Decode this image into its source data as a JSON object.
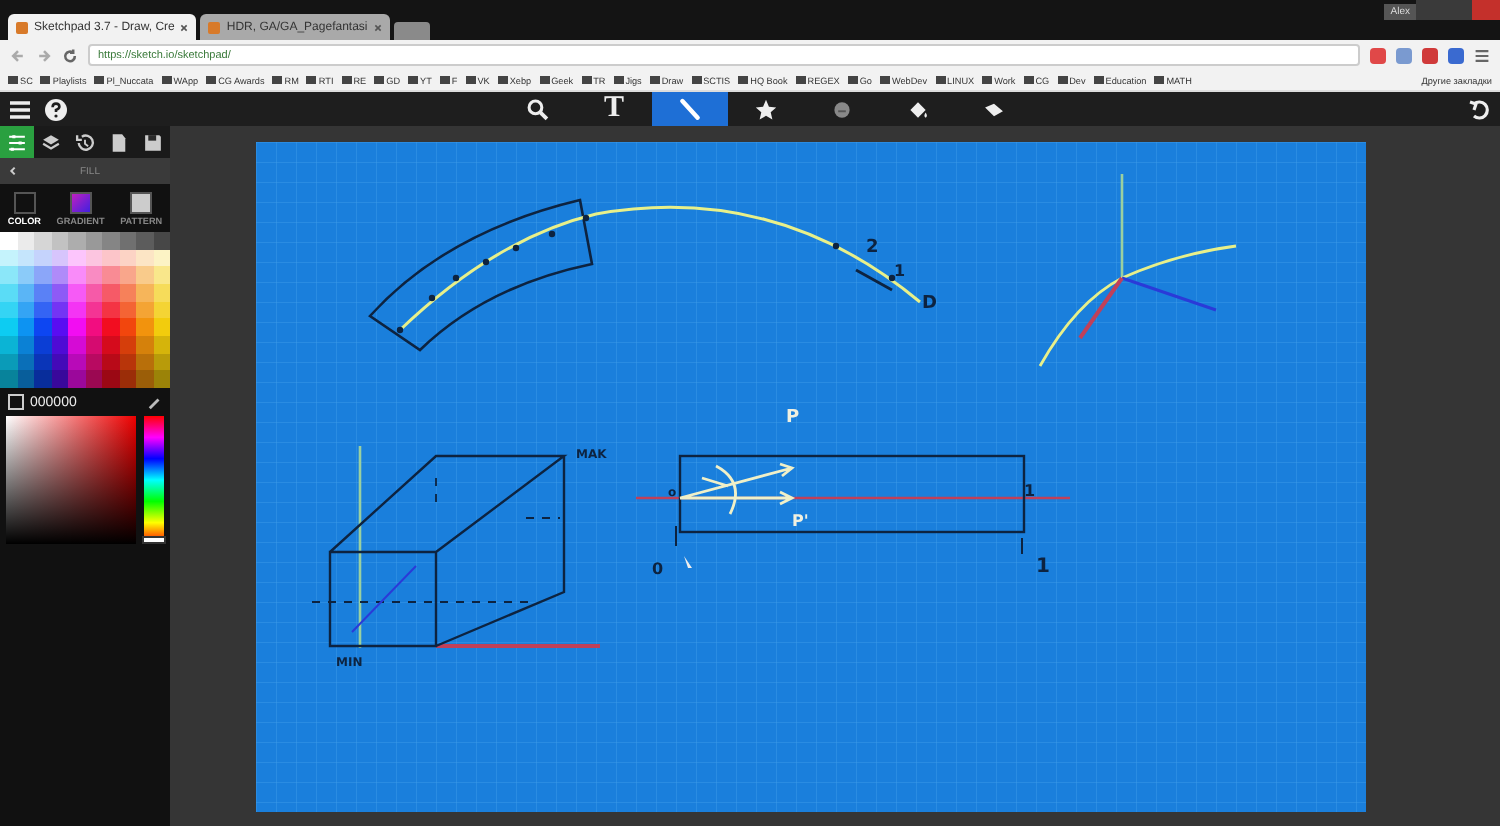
{
  "browser": {
    "tabs": [
      {
        "title": "Sketchpad 3.7 - Draw, Cre",
        "selected": true
      },
      {
        "title": "HDR, GA/GA_Pagefantasi",
        "selected": false
      }
    ],
    "profile": "Alex",
    "url": "https://sketch.io/sketchpad/",
    "bookmarks": [
      "SC",
      "Playlists",
      "Pl_Nuccata",
      "WApp",
      "CG Awards",
      "RM",
      "RTI",
      "RE",
      "GD",
      "YT",
      "F",
      "VK",
      "Xebp",
      "Geek",
      "TR",
      "Jigs",
      "Draw",
      "SCTIS",
      "HQ Book",
      "REGEX",
      "Go",
      "WebDev",
      "LINUX",
      "Work",
      "CG",
      "Dev",
      "Education",
      "MATH"
    ],
    "other_bookmarks": "Другие закладки"
  },
  "toolbar": {
    "tools": [
      {
        "kind": "search",
        "selected": false
      },
      {
        "kind": "text",
        "label": "T",
        "selected": false
      },
      {
        "kind": "pen",
        "selected": true
      },
      {
        "kind": "star",
        "selected": false
      },
      {
        "kind": "emoji",
        "selected": false
      },
      {
        "kind": "fill",
        "selected": false
      },
      {
        "kind": "eraser",
        "selected": false
      }
    ]
  },
  "panel": {
    "tabs": [
      {
        "kind": "sliders",
        "selected": true
      },
      {
        "kind": "layers",
        "selected": false
      },
      {
        "kind": "history",
        "selected": false
      },
      {
        "kind": "page",
        "selected": false
      },
      {
        "kind": "save",
        "selected": false
      }
    ],
    "title": "FILL",
    "fill_types": [
      {
        "label": "COLOR",
        "selected": true
      },
      {
        "label": "GRADIENT",
        "selected": false
      },
      {
        "label": "PATTERN",
        "selected": false
      }
    ],
    "transparent": {
      "checked": false
    },
    "hex": "000000",
    "hue": {
      "level": 0
    }
  },
  "canvas": {
    "labels": [
      "2",
      "1",
      "D",
      "MAK",
      "MIN",
      "P",
      "P'",
      "o",
      "1",
      "0",
      "1"
    ]
  }
}
